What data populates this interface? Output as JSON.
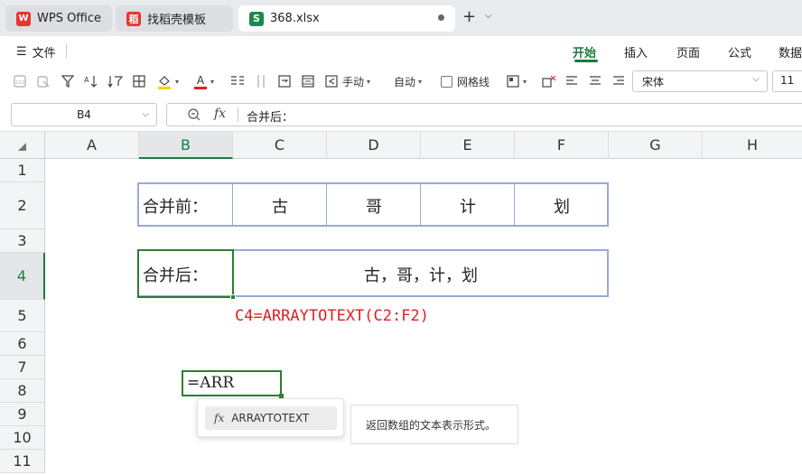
{
  "tabs": {
    "wps": "WPS Office",
    "template": "找稻壳模板",
    "file": "368.xlsx",
    "wps_logo": "W",
    "template_logo": "稻",
    "file_logo": "S"
  },
  "menu": {
    "file": "文件",
    "ribbon_tabs": [
      "开始",
      "插入",
      "页面",
      "公式",
      "数据"
    ]
  },
  "toolbar": {
    "wrap_manual": "手动",
    "wrap_auto": "自动",
    "gridlines": "网格线",
    "font_name": "宋体",
    "font_size": "11",
    "font_color": "#e02020",
    "fill_color": "#f5d200"
  },
  "formula_bar": {
    "cell_ref": "B4",
    "content": "合并后："
  },
  "grid": {
    "columns": [
      "A",
      "B",
      "C",
      "D",
      "E",
      "F",
      "G",
      "H"
    ],
    "rows": [
      "1",
      "2",
      "3",
      "4",
      "5",
      "6",
      "7",
      "8",
      "9",
      "10",
      "11"
    ],
    "active_column": "B",
    "active_row": "4"
  },
  "table1": {
    "label": "合并前：",
    "values": [
      "古",
      "哥",
      "计",
      "划"
    ]
  },
  "table2": {
    "label": "合并后：",
    "result": "古，哥，计，划"
  },
  "note": "C4=ARRAYTOTEXT(C2:F2)",
  "editing": {
    "text": "=ARR"
  },
  "autocomplete": {
    "item": "ARRAYTOTEXT",
    "tip": "返回数组的文本表示形式。"
  },
  "colors": {
    "accent_green": "#1b7a3e",
    "note_red": "#e02020",
    "table_border": "#9aa9d6"
  }
}
